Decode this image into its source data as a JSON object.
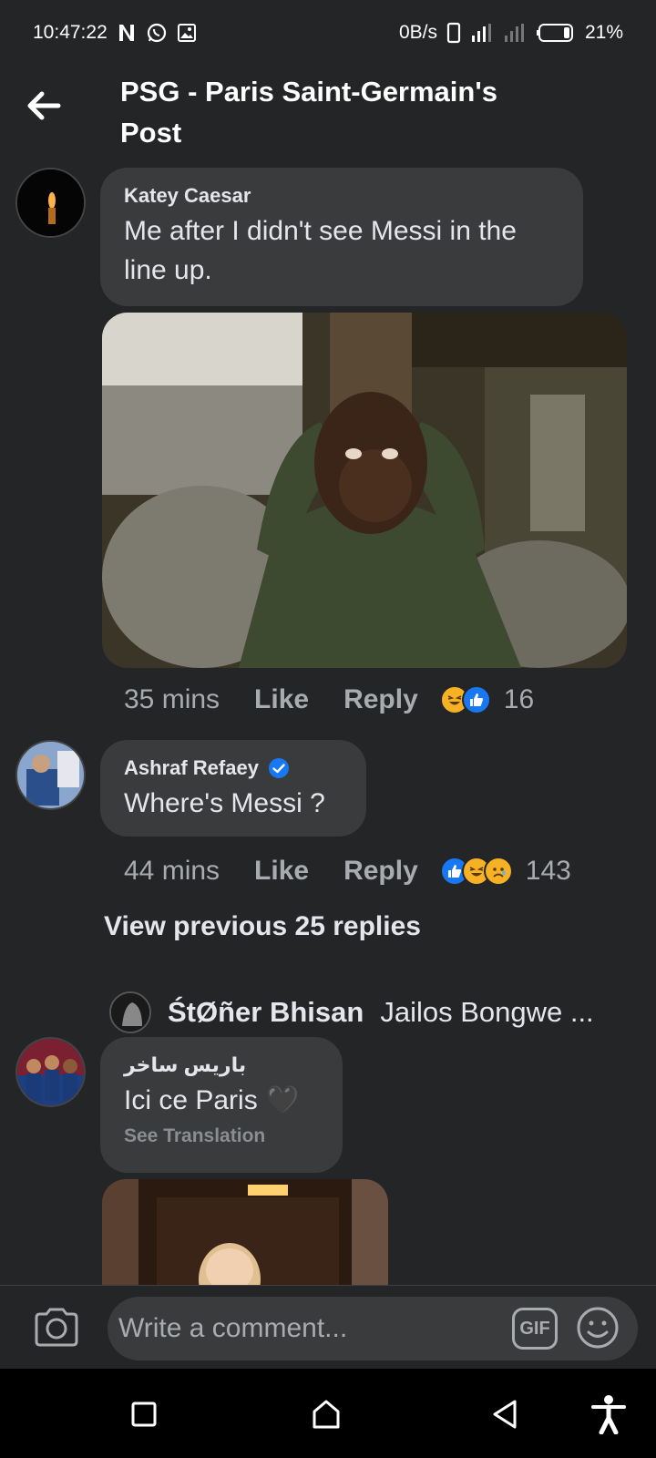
{
  "status_bar": {
    "time": "10:47:22",
    "network_speed": "0B/s",
    "battery": "21%"
  },
  "header": {
    "title": "PSG - Paris Saint-Germain's Post"
  },
  "comments": [
    {
      "author": "Katey Caesar",
      "text": "Me after I didn't see Messi in the line up.",
      "time": "35 mins",
      "like_label": "Like",
      "reply_label": "Reply",
      "reaction_icons": [
        "haha-icon",
        "like-icon"
      ],
      "reaction_count": "16"
    },
    {
      "author": "Ashraf Refaey",
      "verified": true,
      "text": "Where's Messi ?",
      "time": "44 mins",
      "like_label": "Like",
      "reply_label": "Reply",
      "reaction_icons": [
        "like-icon",
        "haha-icon",
        "sad-icon"
      ],
      "reaction_count": "143"
    },
    {
      "author": "باريس ساخر",
      "text": "Ici ce Paris 🖤",
      "see_translation": "See Translation"
    }
  ],
  "view_previous": "View previous 25 replies",
  "reply_preview": {
    "author": "ŚtØñer Bhisan",
    "text": "Jailos Bongwe ..."
  },
  "composer": {
    "placeholder": "Write a comment...",
    "gif_label": "GIF"
  },
  "colors": {
    "background": "#242527",
    "bubble": "#3a3b3c",
    "text": "#e4e6eb",
    "muted": "#a8abaf",
    "facebook_blue": "#1877f2",
    "reaction_yellow": "#f7b125"
  }
}
